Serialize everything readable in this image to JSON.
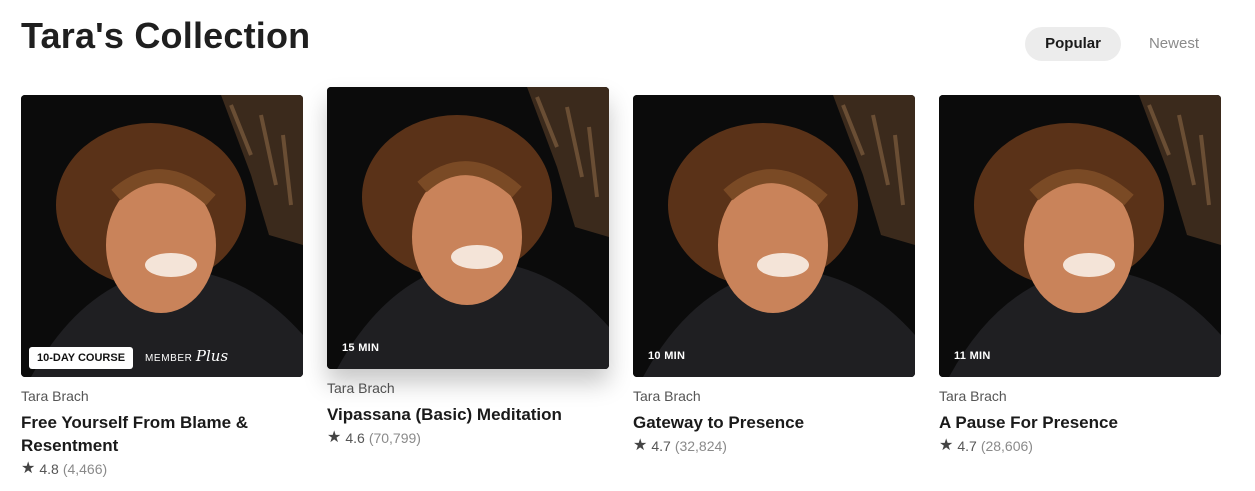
{
  "page_title": "Tara's Collection",
  "sort_tabs": [
    {
      "label": "Popular",
      "active": true
    },
    {
      "label": "Newest",
      "active": false
    }
  ],
  "cards": [
    {
      "badge": "10-DAY COURSE",
      "member_label": "MEMBER",
      "member_plus": "Plus",
      "author": "Tara Brach",
      "title": "Free Yourself From Blame & Resentment",
      "rating": "4.8",
      "count": "(4,466)"
    },
    {
      "duration": "15 MIN",
      "author": "Tara Brach",
      "title": "Vipassana (Basic) Meditation",
      "rating": "4.6",
      "count": "(70,799)"
    },
    {
      "duration": "10 MIN",
      "author": "Tara Brach",
      "title": "Gateway to Presence",
      "rating": "4.7",
      "count": "(32,824)"
    },
    {
      "duration": "11 MIN",
      "author": "Tara Brach",
      "title": "A Pause For Presence",
      "rating": "4.7",
      "count": "(28,606)"
    }
  ],
  "icons": {
    "star": "star-icon"
  }
}
